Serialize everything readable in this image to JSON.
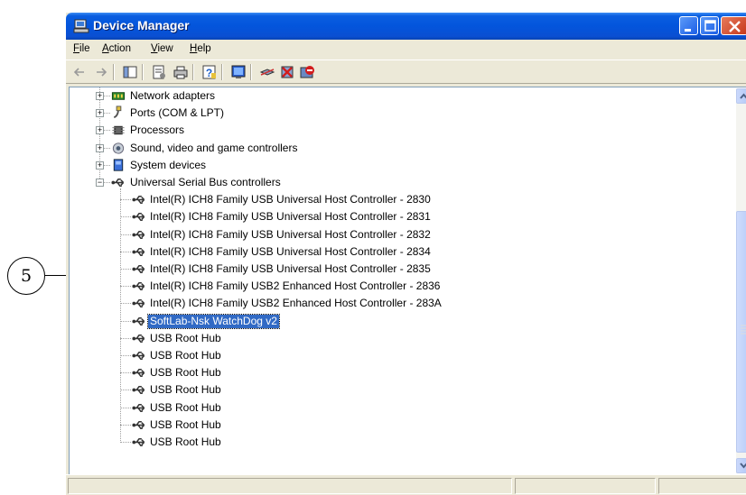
{
  "callout": {
    "number": "5"
  },
  "window": {
    "title": "Device Manager"
  },
  "menu": [
    {
      "underline": "F",
      "rest": "ile"
    },
    {
      "underline": "A",
      "rest": "ction"
    },
    {
      "underline": "V",
      "rest": "iew"
    },
    {
      "underline": "H",
      "rest": "elp"
    }
  ],
  "toolbar_icons": [
    "back-arrow-icon",
    "forward-arrow-icon",
    "show-hide-console-tree-icon",
    "properties-icon",
    "print-icon",
    "help-icon",
    "scan-hardware-icon",
    "update-driver-icon",
    "uninstall-icon",
    "disable-icon"
  ],
  "tree": {
    "categories": [
      {
        "label": "Network adapters",
        "icon": "network-adapter-icon",
        "expanded": false
      },
      {
        "label": "Ports (COM & LPT)",
        "icon": "port-icon",
        "expanded": false
      },
      {
        "label": "Processors",
        "icon": "processor-icon",
        "expanded": false
      },
      {
        "label": "Sound, video and game controllers",
        "icon": "sound-icon",
        "expanded": false
      },
      {
        "label": "System devices",
        "icon": "system-device-icon",
        "expanded": false
      },
      {
        "label": "Universal Serial Bus controllers",
        "icon": "usb-icon",
        "expanded": true
      }
    ],
    "usb_children": [
      {
        "label": "Intel(R) ICH8 Family USB Universal Host Controller - 2830",
        "selected": false
      },
      {
        "label": "Intel(R) ICH8 Family USB Universal Host Controller - 2831",
        "selected": false
      },
      {
        "label": "Intel(R) ICH8 Family USB Universal Host Controller - 2832",
        "selected": false
      },
      {
        "label": "Intel(R) ICH8 Family USB Universal Host Controller - 2834",
        "selected": false
      },
      {
        "label": "Intel(R) ICH8 Family USB Universal Host Controller - 2835",
        "selected": false
      },
      {
        "label": "Intel(R) ICH8 Family USB2 Enhanced Host Controller - 2836",
        "selected": false
      },
      {
        "label": "Intel(R) ICH8 Family USB2 Enhanced Host Controller - 283A",
        "selected": false
      },
      {
        "label": "SoftLab-Nsk WatchDog v2",
        "selected": true
      },
      {
        "label": "USB Root Hub",
        "selected": false
      },
      {
        "label": "USB Root Hub",
        "selected": false
      },
      {
        "label": "USB Root Hub",
        "selected": false
      },
      {
        "label": "USB Root Hub",
        "selected": false
      },
      {
        "label": "USB Root Hub",
        "selected": false
      },
      {
        "label": "USB Root Hub",
        "selected": false
      },
      {
        "label": "USB Root Hub",
        "selected": false
      }
    ]
  },
  "colors": {
    "title_blue": "#0355dc",
    "selection": "#316ac5",
    "window_face": "#ece9d8",
    "close_red": "#c6371a"
  }
}
